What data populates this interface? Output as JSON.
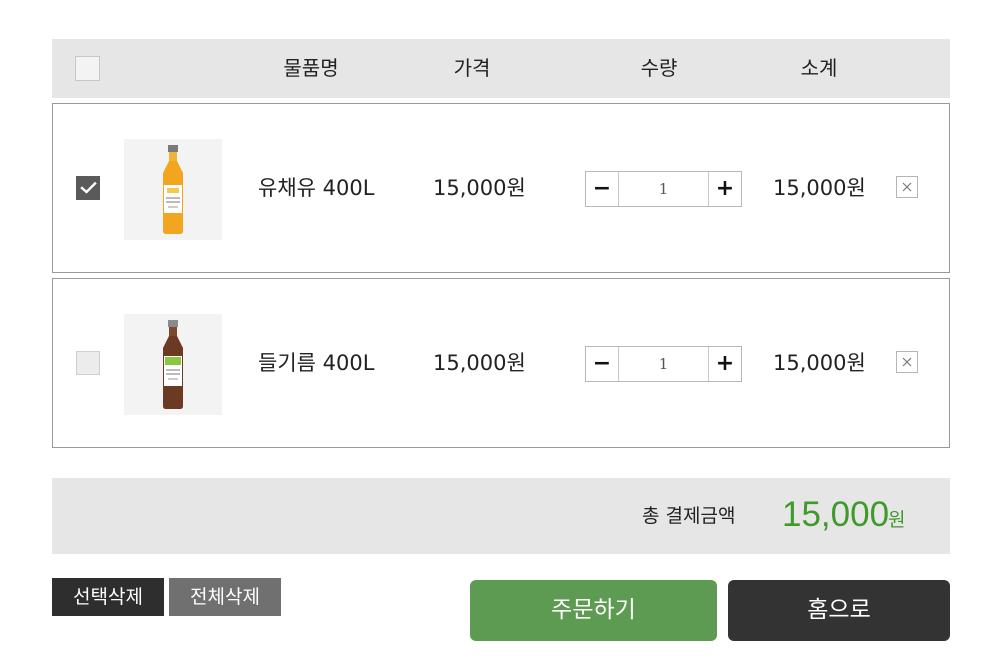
{
  "table": {
    "headers": {
      "name": "물품명",
      "price": "가격",
      "quantity": "수량",
      "subtotal": "소계"
    },
    "select_all_checked": false
  },
  "items": [
    {
      "checked": true,
      "name": "유채유 400L",
      "price": "15,000원",
      "quantity": "1",
      "subtotal": "15,000원",
      "thumb_color": "#f2a51f",
      "label_color": "#f7c948"
    },
    {
      "checked": false,
      "name": "들기름 400L",
      "price": "15,000원",
      "quantity": "1",
      "subtotal": "15,000원",
      "thumb_color": "#6b3a22",
      "label_color": "#8cc63f"
    }
  ],
  "stepper": {
    "minus_label": "−",
    "plus_label": "+"
  },
  "total": {
    "label": "총 결제금액",
    "amount": "15,000",
    "unit": "원",
    "color": "#3f9a2c"
  },
  "buttons": {
    "delete_selected": "선택삭제",
    "delete_all": "전체삭제",
    "order": "주문하기",
    "home": "홈으로"
  },
  "icons": {
    "check": "check-icon",
    "close": "close-icon"
  }
}
